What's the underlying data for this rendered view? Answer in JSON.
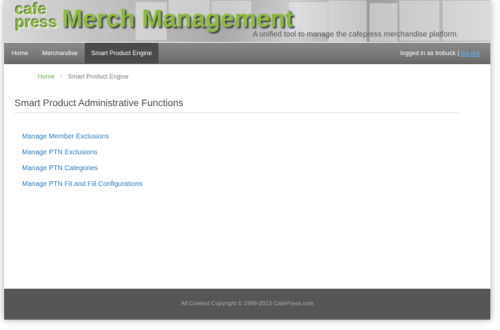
{
  "header": {
    "logo_line1": "cafe",
    "logo_line2": "press",
    "title": "Merch Management",
    "tagline": "A unified tool to manage the cafepress merchandise platform."
  },
  "nav": {
    "items": [
      {
        "label": "Home"
      },
      {
        "label": "Merchandise"
      },
      {
        "label": "Smart Product Engine"
      }
    ],
    "active_index": 2,
    "login_prefix": "logged in as trobuck |",
    "logout_label": "log out"
  },
  "breadcrumb": {
    "home": "Home",
    "separator": "/",
    "current": "Smart Product Engine"
  },
  "main": {
    "heading": "Smart Product Administrative Functions",
    "links": [
      "Manage Member Exclusions",
      "Manage PTN Exclusions",
      "Manage PTN Categories",
      "Manage PTN Fit and Fill Configurations"
    ]
  },
  "footer": {
    "copyright": "All Content Copyright © 1999-2013 CafePress.com"
  },
  "colors": {
    "brand_green": "#8cbb3d",
    "link_blue": "#2a7ab8",
    "nav_active": "#4a4a4a",
    "footer_bg": "#565656"
  }
}
